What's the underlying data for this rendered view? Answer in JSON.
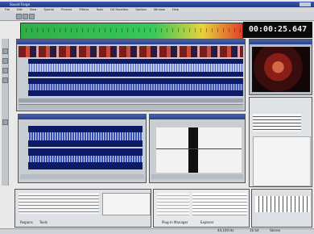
{
  "app": {
    "title": "Sound Forge",
    "menu": [
      "File",
      "Edit",
      "View",
      "Special",
      "Process",
      "Effects",
      "Tools",
      "DX Favorites",
      "Options",
      "Window",
      "Help"
    ]
  },
  "transport": {
    "time": "00:00:25.647"
  },
  "panels": {
    "explorer_tabs": [
      "Regions",
      "Tools"
    ],
    "plugin_tabs": [
      "Plug-In Manager",
      "Explorer"
    ],
    "status": [
      "44,100 Hz",
      "16 bit",
      "Stereo"
    ]
  },
  "colors": {
    "meter_green": "#32c850",
    "meter_yellow": "#e8d23a",
    "meter_red": "#e0402a",
    "wave_bg": "#0d1a66",
    "title_bar": "#3a52a8"
  }
}
